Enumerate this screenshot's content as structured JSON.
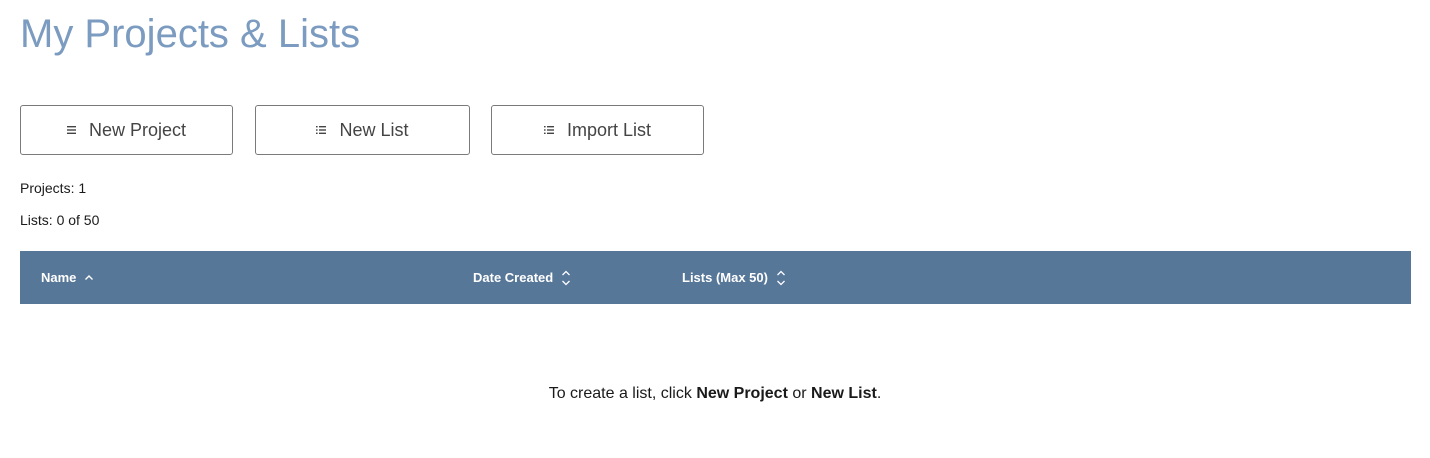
{
  "page": {
    "title": "My Projects & Lists"
  },
  "toolbar": {
    "new_project_label": "New Project",
    "new_list_label": "New List",
    "import_list_label": "Import List",
    "new_project_icon": "menu-lines-icon",
    "new_list_icon": "list-icon",
    "import_list_icon": "list-icon"
  },
  "stats": {
    "projects": "Projects: 1",
    "lists": "Lists: 0 of 50"
  },
  "table": {
    "columns": [
      {
        "label": "Name",
        "sort": "ascending"
      },
      {
        "label": "Date Created",
        "sort": "unsorted"
      },
      {
        "label": "Lists (Max 50)",
        "sort": "unsorted"
      }
    ],
    "header_color": "#577799"
  },
  "empty_state": {
    "prefix": "To create a list, click ",
    "link1": "New Project",
    "middle": " or ",
    "link2": "New List",
    "suffix": "."
  },
  "colors": {
    "title": "#7b9bc0",
    "header_bg": "#577799"
  }
}
